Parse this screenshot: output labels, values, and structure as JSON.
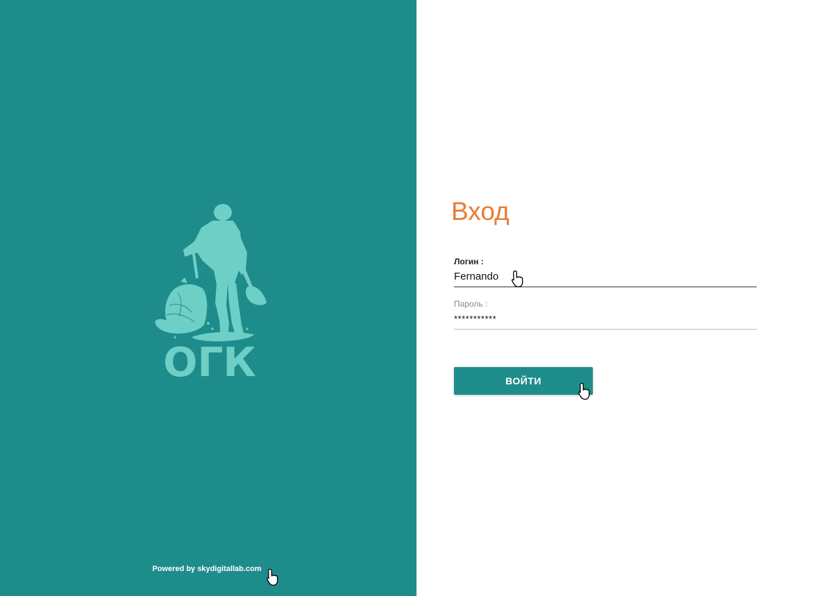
{
  "colors": {
    "brand_teal": "#1f8c8c",
    "logo_light": "#6ecfc6",
    "accent_orange": "#e87a34"
  },
  "left": {
    "logo_text": "ОГК",
    "logo_icon": "miner-with-shovel-icon",
    "powered_prefix": "Powered by ",
    "powered_link": "skydigitallab.com"
  },
  "form": {
    "title": "Вход",
    "login_label": "Логин :",
    "login_value": "Fernando",
    "password_label": "Пароль :",
    "password_value": "***********",
    "submit_label": "ВОЙТИ"
  },
  "cursor_icon": "hand-pointer-icon"
}
